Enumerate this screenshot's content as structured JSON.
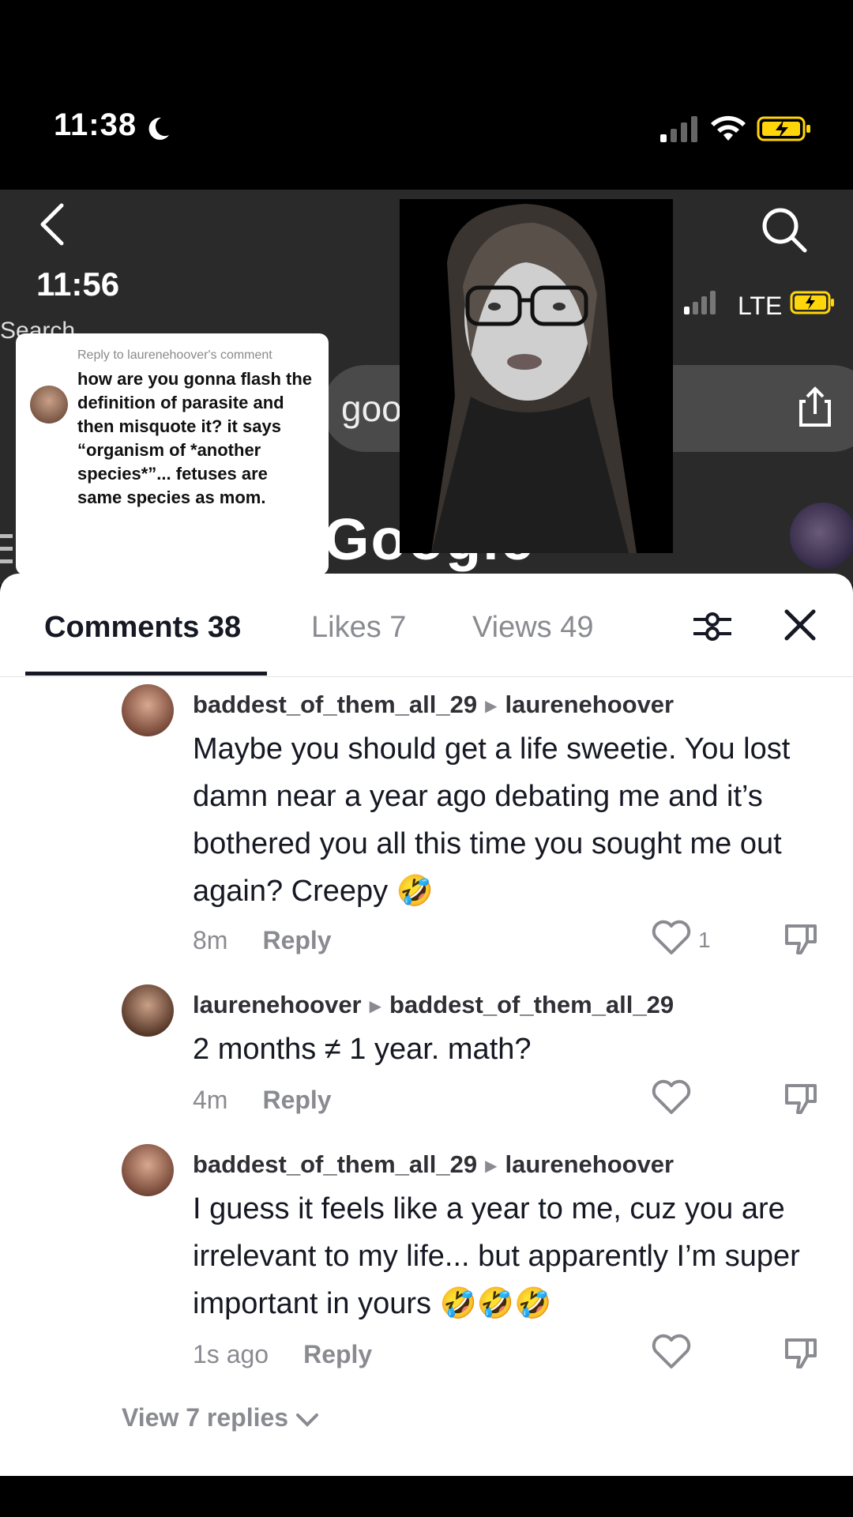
{
  "status_bar": {
    "time": "11:38"
  },
  "video": {
    "inner_time": "11:56",
    "inner_search_label": "Search",
    "inner_network": "LTE",
    "url_partial": "goo",
    "google_partial": "Google"
  },
  "reply_card": {
    "header": "Reply to laurenehoover's comment",
    "text": "how are you gonna flash the definition of parasite and then misquote it? it says “organism of *another species*”... fetuses are same species as mom."
  },
  "tabs": [
    {
      "label": "Comments 38"
    },
    {
      "label": "Likes 7"
    },
    {
      "label": "Views 49"
    }
  ],
  "comments": [
    {
      "user": "baddest_of_them_all_29",
      "reply_to": "laurenehoover",
      "text": "Maybe you should get a life sweetie. You lost damn near a year ago debating me and it’s bothered you all this time you sought me out again? Creepy 🤣",
      "time": "8m",
      "reply_label": "Reply",
      "likes": "1"
    },
    {
      "user": "laurenehoover",
      "reply_to": "baddest_of_them_all_29",
      "text": "2 months ≠ 1 year. math?",
      "time": "4m",
      "reply_label": "Reply"
    },
    {
      "user": "baddest_of_them_all_29",
      "reply_to": "laurenehoover",
      "text": "I guess it feels like a year to me, cuz you are irrelevant to my life... but apparently I’m super important in yours 🤣🤣🤣",
      "time": "1s ago",
      "reply_label": "Reply"
    }
  ],
  "view_replies": "View 7 replies",
  "icons": {
    "back": "chevron-left-icon",
    "search": "search-icon",
    "filter": "filter-icon",
    "close": "close-icon",
    "like": "heart-icon",
    "dislike": "thumbs-down-icon"
  }
}
